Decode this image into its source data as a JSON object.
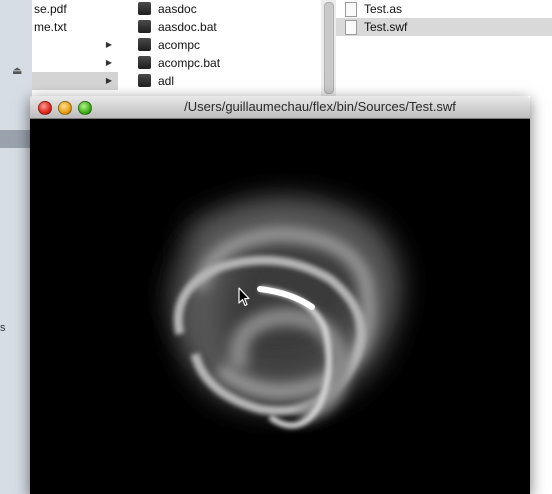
{
  "finder": {
    "column1": [
      {
        "label": "se.pdf",
        "has_arrow": false,
        "selected": false
      },
      {
        "label": "me.txt",
        "has_arrow": false,
        "selected": false
      },
      {
        "label": "",
        "has_arrow": true,
        "selected": false
      },
      {
        "label": "",
        "has_arrow": true,
        "selected": false
      },
      {
        "label": "",
        "has_arrow": true,
        "selected": true
      }
    ],
    "column2": [
      {
        "label": "aasdoc"
      },
      {
        "label": "aasdoc.bat"
      },
      {
        "label": "acompc"
      },
      {
        "label": "acompc.bat"
      },
      {
        "label": "adl"
      }
    ],
    "column3": [
      {
        "label": "Test.as",
        "selected": false
      },
      {
        "label": "Test.swf",
        "selected": true
      }
    ],
    "eject_icon": "eject-icon",
    "sidebar_fragment": "s"
  },
  "player": {
    "title": "/Users/guillaumechau/flex/bin/Sources/Test.swf",
    "buttons": [
      "close",
      "minimize",
      "zoom"
    ]
  },
  "colors": {
    "canvas_bg": "#000000",
    "close": "#e0291d",
    "minimize": "#e9a018",
    "zoom": "#3fb11c"
  }
}
